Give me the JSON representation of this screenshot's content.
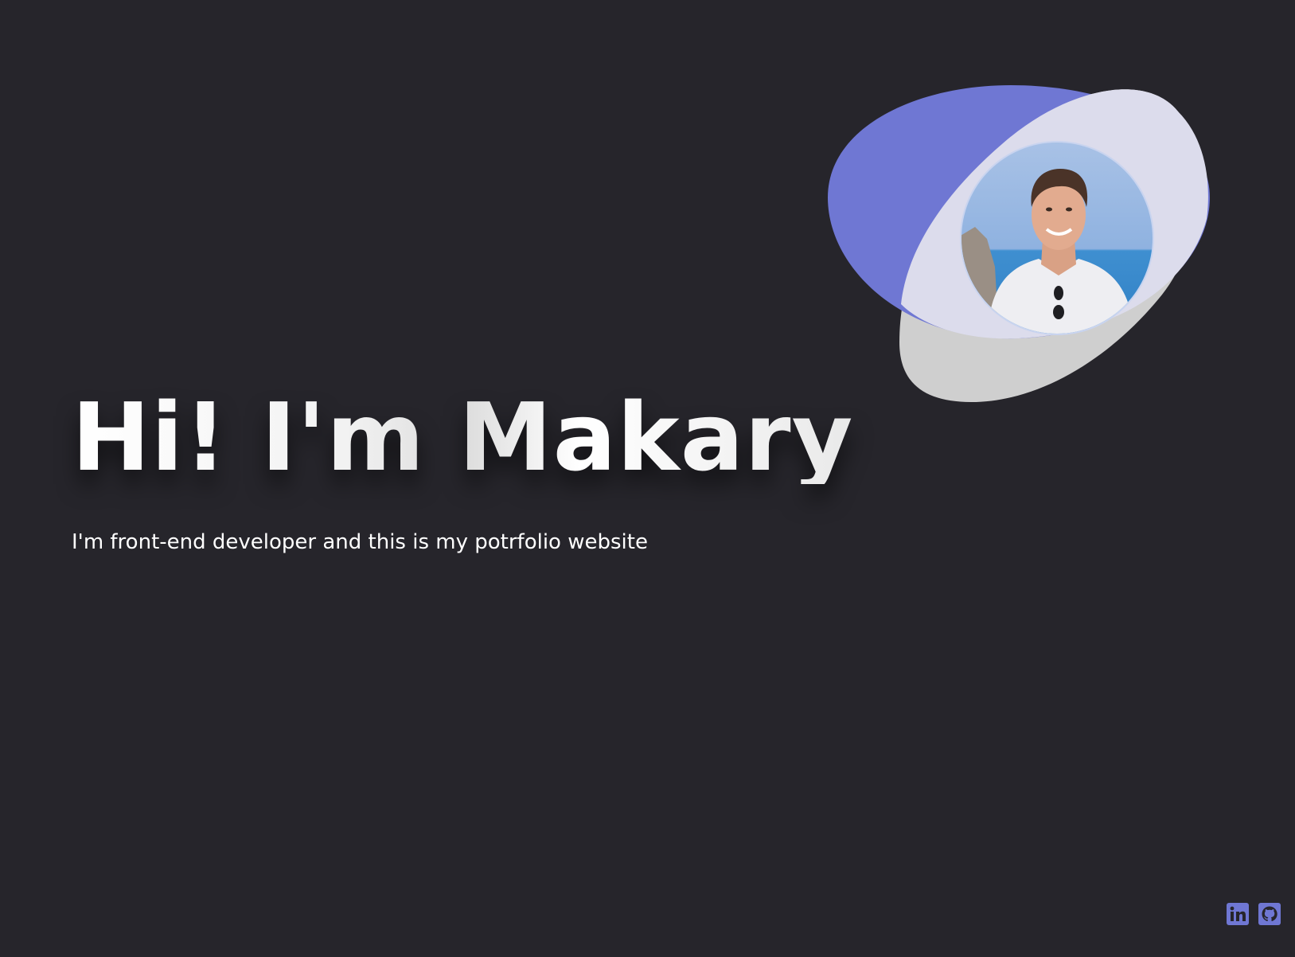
{
  "hero": {
    "title": "Hi! I'm Makary",
    "subtitle": "I'm front-end developer and this is my potrfolio website"
  },
  "avatar": {
    "alt": "Portrait photo of Makary"
  },
  "socials": [
    {
      "icon": "linkedin-icon",
      "label": "LinkedIn"
    },
    {
      "icon": "github-icon",
      "label": "GitHub"
    }
  ],
  "colors": {
    "background": "#26252b",
    "accent": "#6f77d3",
    "blob_light": "#dcdcec",
    "blob_gray": "#cfcfcf",
    "text": "#ffffff"
  }
}
